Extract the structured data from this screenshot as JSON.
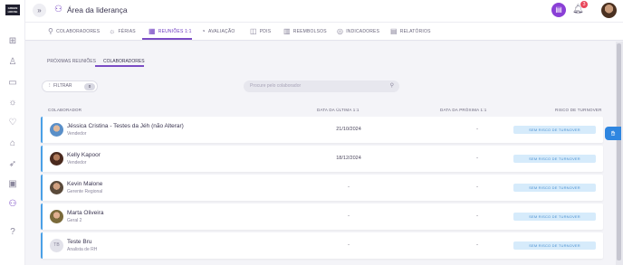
{
  "app": {
    "logo_text": "GREEN HOUSE"
  },
  "header": {
    "title": "Área da liderança",
    "notification_count": "3",
    "icons": [
      "collapse-icon",
      "people-icon",
      "chat-icon",
      "bell-icon"
    ]
  },
  "sidebar": {
    "icons": [
      "dashboard-icon",
      "user-icon",
      "id-card-icon",
      "sun-icon",
      "heart-icon",
      "bag-icon",
      "rocket-icon",
      "briefcase-icon",
      "people-icon",
      "help-icon"
    ]
  },
  "nav": {
    "items": [
      {
        "label": "COLABORADORES",
        "icon": "person-search-icon"
      },
      {
        "label": "FÉRIAS",
        "icon": "sun-icon"
      },
      {
        "label": "REUNIÕES 1:1",
        "icon": "calendar-icon"
      },
      {
        "label": "AVALIAÇÃO",
        "icon": "gauge-icon"
      },
      {
        "label": "PDIS",
        "icon": "chart-icon"
      },
      {
        "label": "REEMBOLSOS",
        "icon": "wallet-icon"
      },
      {
        "label": "INDICADORES",
        "icon": "indicator-icon"
      },
      {
        "label": "RELATÓRIOS",
        "icon": "report-icon"
      }
    ],
    "active_index": 2
  },
  "subtabs": {
    "items": [
      "PRÓXIMAS REUNIÕES",
      "COLABORADORES"
    ],
    "active_index": 1
  },
  "filter": {
    "label": "FILTRAR",
    "count": "0"
  },
  "search": {
    "placeholder": "Procure pelo colaborador"
  },
  "table": {
    "headers": [
      "COLABORADOR",
      "DATA DA ÚLTIMA 1:1",
      "DATA DA PRÓXIMA 1:1",
      "RISCO DE TURNOVER"
    ],
    "rows": [
      {
        "name": "Jéssica Cristina - Testes da Jéh (não Alterar)",
        "role": "Vendedor",
        "last": "21/10/2024",
        "next": "-",
        "risk": "SEM RISCO DE TURNOVER",
        "initials": ""
      },
      {
        "name": "Kelly Kapoor",
        "role": "Vendedor",
        "last": "18/12/2024",
        "next": "-",
        "risk": "SEM RISCO DE TURNOVER",
        "initials": ""
      },
      {
        "name": "Kevin Malone",
        "role": "Gerente Regional",
        "last": "-",
        "next": "-",
        "risk": "SEM RISCO DE TURNOVER",
        "initials": ""
      },
      {
        "name": "Marta Oliveira",
        "role": "Geral 2",
        "last": "-",
        "next": "-",
        "risk": "SEM RISCO DE TURNOVER",
        "initials": ""
      },
      {
        "name": "Teste Bru",
        "role": "Analista de RH",
        "last": "-",
        "next": "-",
        "risk": "SEM RISCO DE TURNOVER",
        "initials": "TB"
      }
    ]
  },
  "colors": {
    "accent": "#7b4cc4",
    "row_border": "#4aa0e6",
    "risk_bg": "#d6ebfb",
    "risk_text": "#4a90d0",
    "badge": "#e8465a"
  }
}
